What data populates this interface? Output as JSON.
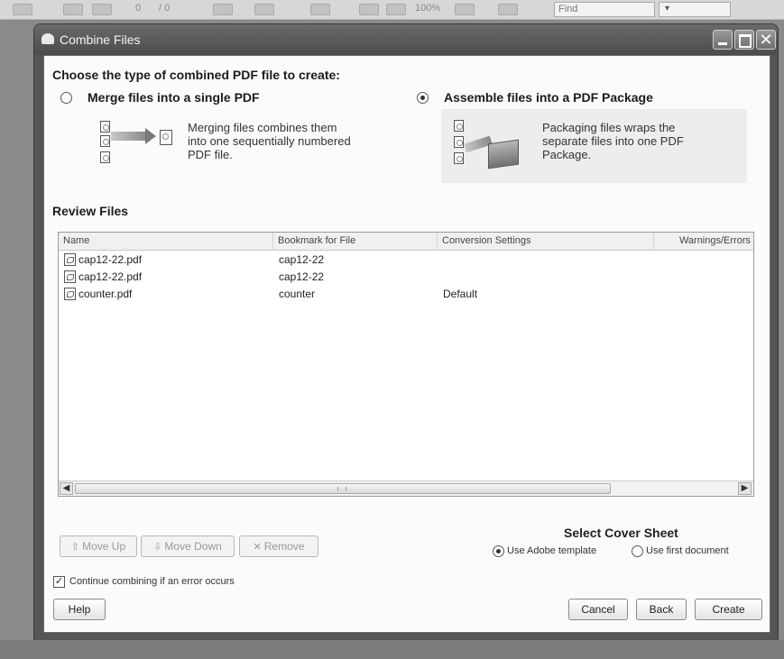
{
  "toolbar": {
    "page_current": "0",
    "page_total": "/ 0",
    "zoom": "100%",
    "find_placeholder": "Find"
  },
  "dialog": {
    "title": "Combine Files",
    "heading": "Choose the type of combined PDF file to create:",
    "options": [
      {
        "label": "Merge files into a single PDF",
        "description": [
          "Merging files combines them",
          "into one sequentially numbered",
          "PDF file."
        ],
        "selected": false
      },
      {
        "label": "Assemble files into a PDF Package",
        "description": [
          "Packaging files wraps the",
          "separate files into one PDF",
          "Package."
        ],
        "selected": true
      }
    ],
    "review_title": "Review Files",
    "columns": [
      "Name",
      "Bookmark for File",
      "Conversion Settings",
      "Warnings/Errors"
    ],
    "files": [
      {
        "name": "cap12-22.pdf",
        "bookmark": "cap12-22",
        "conversion": "",
        "warnings": ""
      },
      {
        "name": "cap12-22.pdf",
        "bookmark": "cap12-22",
        "conversion": "",
        "warnings": ""
      },
      {
        "name": "counter.pdf",
        "bookmark": "counter",
        "conversion": "Default",
        "warnings": ""
      }
    ],
    "move_up_label": "Move Up",
    "move_down_label": "Move Down",
    "remove_label": "Remove",
    "cover_sheet_title": "Select Cover Sheet",
    "cover_options": [
      {
        "label": "Use Adobe template",
        "selected": true
      },
      {
        "label": "Use first document",
        "selected": false
      }
    ],
    "continue_label": "Continue combining if an error occurs",
    "continue_checked": true,
    "help_label": "Help",
    "cancel_label": "Cancel",
    "back_label": "Back",
    "create_label": "Create"
  }
}
